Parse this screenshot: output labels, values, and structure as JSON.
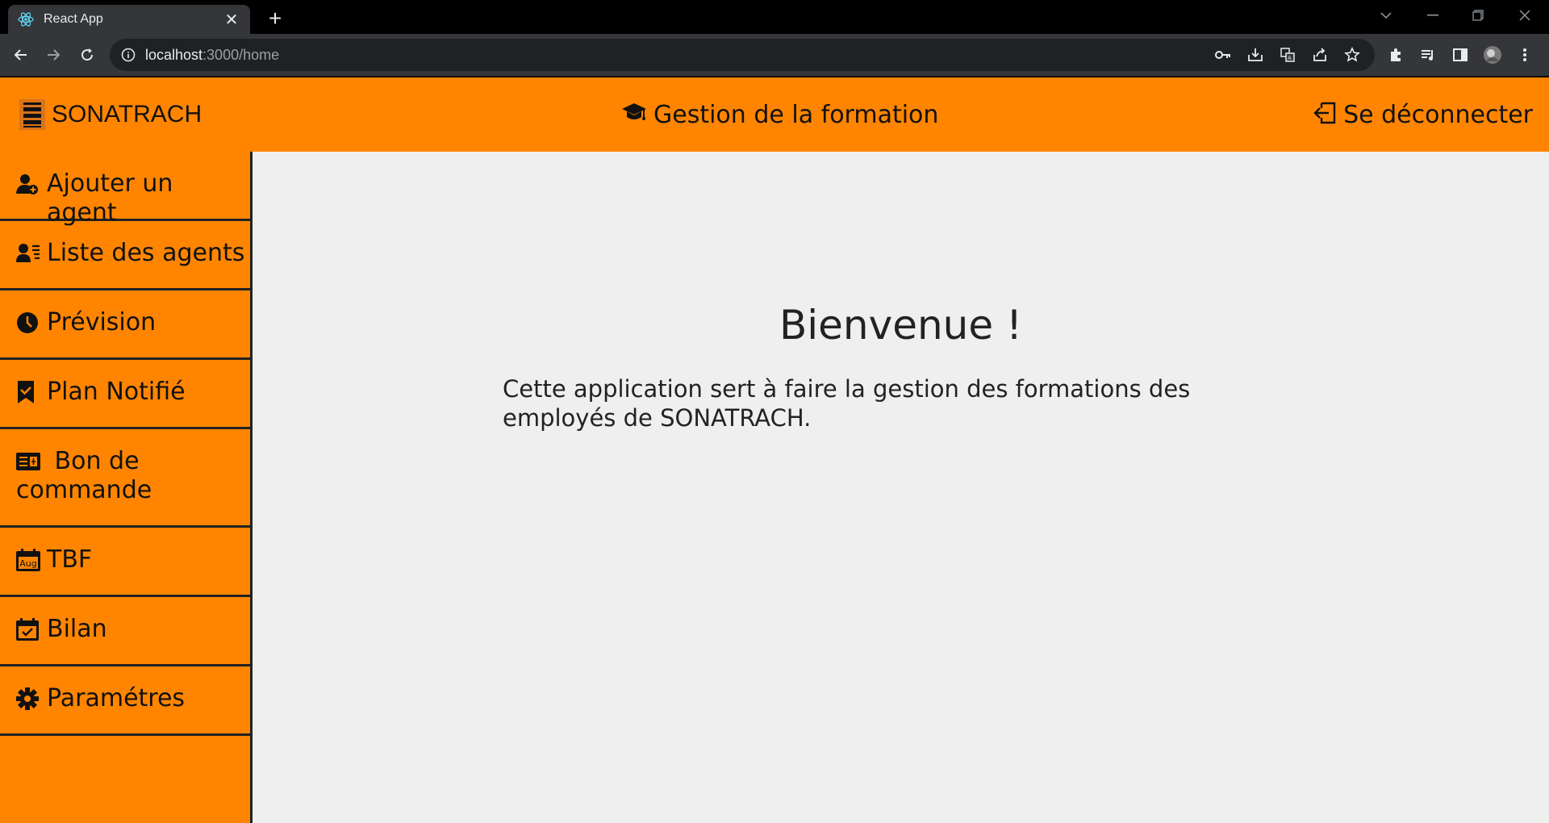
{
  "browser": {
    "tab_title": "React App",
    "url_host": "localhost",
    "url_rest": ":3000/home"
  },
  "header": {
    "brand": "SONATRACH",
    "title": "Gestion de la formation",
    "logout": "Se déconnecter"
  },
  "sidebar": {
    "items": [
      {
        "label": "Ajouter un agent",
        "icon": "user-plus-icon"
      },
      {
        "label": "Liste des agents",
        "icon": "user-list-icon"
      },
      {
        "label": "Prévision",
        "icon": "clock-icon"
      },
      {
        "label": "Plan Notifié",
        "icon": "bookmark-check-icon"
      },
      {
        "label": "Bon de commande",
        "icon": "order-card-icon"
      },
      {
        "label": "TBF",
        "icon": "calendar-month-icon",
        "icon_text": "Aug"
      },
      {
        "label": "Bilan",
        "icon": "calendar-check-icon"
      },
      {
        "label": "Paramétres",
        "icon": "gear-icon"
      }
    ]
  },
  "main": {
    "heading": "Bienvenue !",
    "description": "Cette application sert à faire la gestion des formations des employés de SONATRACH."
  },
  "colors": {
    "accent": "#ff8500",
    "content_bg": "#efefef",
    "chrome_bg": "#35363a"
  }
}
